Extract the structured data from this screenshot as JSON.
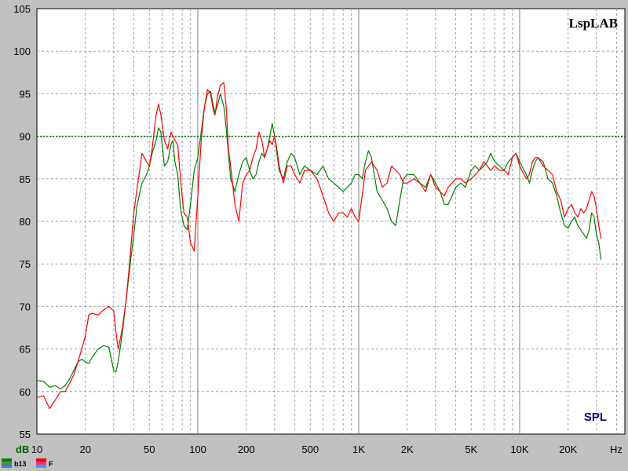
{
  "chart_data": {
    "type": "line",
    "brand": "LspLAB",
    "measurement": "SPL",
    "y_unit": "dB",
    "x_unit": "Hz",
    "x_scale": "log",
    "xlim": [
      10,
      20000
    ],
    "ylim": [
      55,
      105
    ],
    "y_ticks": [
      55,
      60,
      65,
      70,
      75,
      80,
      85,
      90,
      95,
      100,
      105
    ],
    "x_tick_labels": [
      {
        "value": 10,
        "label": "10"
      },
      {
        "value": 20,
        "label": "20"
      },
      {
        "value": 50,
        "label": "50"
      },
      {
        "value": 100,
        "label": "100"
      },
      {
        "value": 200,
        "label": "200"
      },
      {
        "value": 500,
        "label": "500"
      },
      {
        "value": 1000,
        "label": "1K"
      },
      {
        "value": 2000,
        "label": "2K"
      },
      {
        "value": 5000,
        "label": "5K"
      },
      {
        "value": 10000,
        "label": "10K"
      },
      {
        "value": 20000,
        "label": "20K"
      }
    ],
    "grid": true,
    "reference_line": {
      "y": 90,
      "color": "#006400",
      "style": "dotted"
    },
    "series": [
      {
        "name": "b13",
        "color": "#008000",
        "points": [
          [
            10,
            61.3
          ],
          [
            11,
            61.2
          ],
          [
            12,
            60.5
          ],
          [
            13,
            60.7
          ],
          [
            14,
            60.3
          ],
          [
            15,
            60.7
          ],
          [
            16,
            61.5
          ],
          [
            17,
            62.5
          ],
          [
            18,
            63.5
          ],
          [
            19,
            63.8
          ],
          [
            20,
            63.5
          ],
          [
            21,
            63.3
          ],
          [
            22,
            64.0
          ],
          [
            24,
            65.0
          ],
          [
            26,
            65.4
          ],
          [
            28,
            65.2
          ],
          [
            30,
            62.5
          ],
          [
            31,
            62.3
          ],
          [
            32,
            63.5
          ],
          [
            34,
            67.0
          ],
          [
            36,
            71.0
          ],
          [
            38,
            75.0
          ],
          [
            40,
            78.5
          ],
          [
            42,
            82.0
          ],
          [
            45,
            84.5
          ],
          [
            48,
            85.5
          ],
          [
            50,
            86.5
          ],
          [
            52,
            88.0
          ],
          [
            55,
            89.5
          ],
          [
            57,
            91.0
          ],
          [
            59,
            90.5
          ],
          [
            62,
            86.5
          ],
          [
            65,
            87.0
          ],
          [
            68,
            89.0
          ],
          [
            70,
            89.5
          ],
          [
            72,
            87.0
          ],
          [
            75,
            85.5
          ],
          [
            78,
            81.5
          ],
          [
            82,
            79.5
          ],
          [
            86,
            79.0
          ],
          [
            90,
            82.0
          ],
          [
            95,
            86.0
          ],
          [
            100,
            87.5
          ],
          [
            105,
            90.5
          ],
          [
            110,
            93.5
          ],
          [
            115,
            95.0
          ],
          [
            120,
            95.3
          ],
          [
            125,
            93.5
          ],
          [
            128,
            92.8
          ],
          [
            132,
            93.5
          ],
          [
            138,
            95.0
          ],
          [
            145,
            93.5
          ],
          [
            150,
            91.0
          ],
          [
            155,
            88.0
          ],
          [
            160,
            85.0
          ],
          [
            170,
            83.5
          ],
          [
            180,
            85.5
          ],
          [
            190,
            87.0
          ],
          [
            200,
            87.5
          ],
          [
            210,
            86.0
          ],
          [
            220,
            85.0
          ],
          [
            230,
            85.5
          ],
          [
            240,
            87.0
          ],
          [
            250,
            88.0
          ],
          [
            260,
            87.5
          ],
          [
            270,
            88.5
          ],
          [
            280,
            90.0
          ],
          [
            290,
            91.5
          ],
          [
            300,
            90.0
          ],
          [
            310,
            88.0
          ],
          [
            320,
            86.0
          ],
          [
            340,
            85.0
          ],
          [
            360,
            87.0
          ],
          [
            380,
            88.0
          ],
          [
            400,
            87.5
          ],
          [
            430,
            85.5
          ],
          [
            460,
            86.5
          ],
          [
            500,
            86.0
          ],
          [
            550,
            85.5
          ],
          [
            600,
            86.5
          ],
          [
            650,
            85.0
          ],
          [
            700,
            84.5
          ],
          [
            750,
            84.0
          ],
          [
            800,
            83.5
          ],
          [
            850,
            84.0
          ],
          [
            900,
            84.5
          ],
          [
            950,
            85.5
          ],
          [
            1000,
            85.5
          ],
          [
            1050,
            85.0
          ],
          [
            1100,
            87.0
          ],
          [
            1150,
            88.3
          ],
          [
            1200,
            87.5
          ],
          [
            1300,
            83.5
          ],
          [
            1400,
            82.5
          ],
          [
            1500,
            81.5
          ],
          [
            1600,
            80.0
          ],
          [
            1700,
            79.5
          ],
          [
            1800,
            82.5
          ],
          [
            1900,
            85.0
          ],
          [
            2000,
            85.5
          ],
          [
            2200,
            85.5
          ],
          [
            2400,
            84.5
          ],
          [
            2600,
            84.0
          ],
          [
            2800,
            85.5
          ],
          [
            3000,
            84.5
          ],
          [
            3200,
            83.5
          ],
          [
            3400,
            82.0
          ],
          [
            3600,
            82.0
          ],
          [
            3800,
            83.0
          ],
          [
            4000,
            84.0
          ],
          [
            4300,
            84.5
          ],
          [
            4600,
            84.0
          ],
          [
            5000,
            86.0
          ],
          [
            5300,
            86.5
          ],
          [
            5600,
            86.0
          ],
          [
            6000,
            86.5
          ],
          [
            6300,
            87.0
          ],
          [
            6600,
            88.0
          ],
          [
            7000,
            87.0
          ],
          [
            7500,
            86.5
          ],
          [
            8000,
            86.0
          ],
          [
            8500,
            87.0
          ],
          [
            9000,
            87.5
          ],
          [
            9500,
            88.0
          ],
          [
            10000,
            87.0
          ],
          [
            11000,
            85.5
          ],
          [
            11500,
            84.5
          ],
          [
            12000,
            86.0
          ],
          [
            12500,
            87.0
          ],
          [
            13000,
            87.5
          ],
          [
            14000,
            87.0
          ],
          [
            15000,
            85.0
          ],
          [
            16000,
            84.5
          ],
          [
            17000,
            83.0
          ],
          [
            18000,
            81.0
          ],
          [
            19000,
            79.5
          ],
          [
            20000,
            79.2
          ],
          [
            21000,
            80.0
          ],
          [
            22000,
            80.5
          ],
          [
            23000,
            79.5
          ],
          [
            24000,
            79.0
          ],
          [
            25000,
            78.5
          ],
          [
            26000,
            78.0
          ],
          [
            27000,
            79.0
          ],
          [
            28000,
            81.0
          ],
          [
            29000,
            80.5
          ],
          [
            30000,
            78.5
          ],
          [
            31000,
            77.5
          ],
          [
            32000,
            75.5
          ]
        ]
      },
      {
        "name": "F",
        "color": "#ff0000",
        "points": [
          [
            10,
            59.3
          ],
          [
            11,
            59.5
          ],
          [
            12,
            58.0
          ],
          [
            13,
            59.0
          ],
          [
            14,
            60.0
          ],
          [
            15,
            60.0
          ],
          [
            16,
            61.0
          ],
          [
            17,
            62.0
          ],
          [
            18,
            63.5
          ],
          [
            19,
            65.0
          ],
          [
            20,
            66.5
          ],
          [
            21,
            69.0
          ],
          [
            22,
            69.2
          ],
          [
            24,
            69.0
          ],
          [
            26,
            69.6
          ],
          [
            28,
            70.0
          ],
          [
            30,
            69.5
          ],
          [
            31,
            67.0
          ],
          [
            32,
            65.0
          ],
          [
            34,
            67.5
          ],
          [
            36,
            71.0
          ],
          [
            38,
            76.0
          ],
          [
            40,
            81.0
          ],
          [
            42,
            84.0
          ],
          [
            45,
            88.0
          ],
          [
            48,
            87.0
          ],
          [
            50,
            86.5
          ],
          [
            52,
            88.5
          ],
          [
            55,
            92.5
          ],
          [
            57,
            93.8
          ],
          [
            59,
            92.5
          ],
          [
            62,
            89.5
          ],
          [
            65,
            88.5
          ],
          [
            68,
            90.5
          ],
          [
            70,
            90.0
          ],
          [
            72,
            89.5
          ],
          [
            75,
            89.0
          ],
          [
            78,
            85.0
          ],
          [
            82,
            81.0
          ],
          [
            86,
            80.5
          ],
          [
            90,
            77.5
          ],
          [
            95,
            76.5
          ],
          [
            100,
            83.0
          ],
          [
            105,
            89.5
          ],
          [
            110,
            93.5
          ],
          [
            115,
            95.5
          ],
          [
            120,
            95.0
          ],
          [
            125,
            93.0
          ],
          [
            128,
            92.5
          ],
          [
            132,
            94.5
          ],
          [
            138,
            96.0
          ],
          [
            145,
            96.3
          ],
          [
            150,
            93.5
          ],
          [
            155,
            88.5
          ],
          [
            160,
            86.5
          ],
          [
            170,
            82.0
          ],
          [
            180,
            80.0
          ],
          [
            190,
            84.5
          ],
          [
            200,
            85.5
          ],
          [
            210,
            86.0
          ],
          [
            220,
            87.5
          ],
          [
            230,
            88.5
          ],
          [
            240,
            90.5
          ],
          [
            250,
            89.5
          ],
          [
            260,
            87.5
          ],
          [
            270,
            88.5
          ],
          [
            280,
            89.5
          ],
          [
            290,
            89.0
          ],
          [
            300,
            90.0
          ],
          [
            310,
            88.5
          ],
          [
            320,
            86.5
          ],
          [
            340,
            84.5
          ],
          [
            360,
            86.5
          ],
          [
            380,
            86.5
          ],
          [
            400,
            85.5
          ],
          [
            430,
            84.5
          ],
          [
            460,
            86.0
          ],
          [
            500,
            86.0
          ],
          [
            550,
            85.0
          ],
          [
            600,
            83.0
          ],
          [
            650,
            81.0
          ],
          [
            700,
            80.0
          ],
          [
            750,
            81.0
          ],
          [
            800,
            81.0
          ],
          [
            850,
            80.5
          ],
          [
            900,
            81.5
          ],
          [
            950,
            80.5
          ],
          [
            1000,
            80.0
          ],
          [
            1050,
            83.0
          ],
          [
            1100,
            86.0
          ],
          [
            1150,
            86.5
          ],
          [
            1200,
            87.0
          ],
          [
            1300,
            86.0
          ],
          [
            1400,
            84.0
          ],
          [
            1500,
            84.5
          ],
          [
            1600,
            86.5
          ],
          [
            1700,
            86.0
          ],
          [
            1800,
            85.5
          ],
          [
            1900,
            84.5
          ],
          [
            2000,
            84.5
          ],
          [
            2200,
            85.0
          ],
          [
            2400,
            84.5
          ],
          [
            2600,
            83.5
          ],
          [
            2800,
            85.5
          ],
          [
            3000,
            84.0
          ],
          [
            3200,
            83.5
          ],
          [
            3400,
            83.0
          ],
          [
            3600,
            84.0
          ],
          [
            3800,
            84.5
          ],
          [
            4000,
            85.0
          ],
          [
            4300,
            85.0
          ],
          [
            4600,
            84.5
          ],
          [
            5000,
            85.0
          ],
          [
            5300,
            85.5
          ],
          [
            5600,
            86.0
          ],
          [
            6000,
            87.0
          ],
          [
            6300,
            86.5
          ],
          [
            6600,
            86.0
          ],
          [
            7000,
            86.5
          ],
          [
            7500,
            86.0
          ],
          [
            8000,
            86.0
          ],
          [
            8500,
            85.5
          ],
          [
            9000,
            87.5
          ],
          [
            9500,
            88.0
          ],
          [
            10000,
            86.5
          ],
          [
            11000,
            85.0
          ],
          [
            11500,
            85.5
          ],
          [
            12000,
            87.0
          ],
          [
            12500,
            87.5
          ],
          [
            13000,
            87.5
          ],
          [
            14000,
            86.5
          ],
          [
            15000,
            86.0
          ],
          [
            16000,
            85.5
          ],
          [
            17000,
            83.5
          ],
          [
            18000,
            82.5
          ],
          [
            19000,
            80.5
          ],
          [
            20000,
            81.5
          ],
          [
            21000,
            82.0
          ],
          [
            22000,
            81.0
          ],
          [
            23000,
            80.5
          ],
          [
            24000,
            81.5
          ],
          [
            25000,
            81.0
          ],
          [
            26000,
            81.5
          ],
          [
            27000,
            82.5
          ],
          [
            28000,
            83.5
          ],
          [
            29000,
            83.0
          ],
          [
            30000,
            81.5
          ],
          [
            31000,
            79.5
          ],
          [
            32000,
            78.0
          ]
        ]
      }
    ]
  }
}
